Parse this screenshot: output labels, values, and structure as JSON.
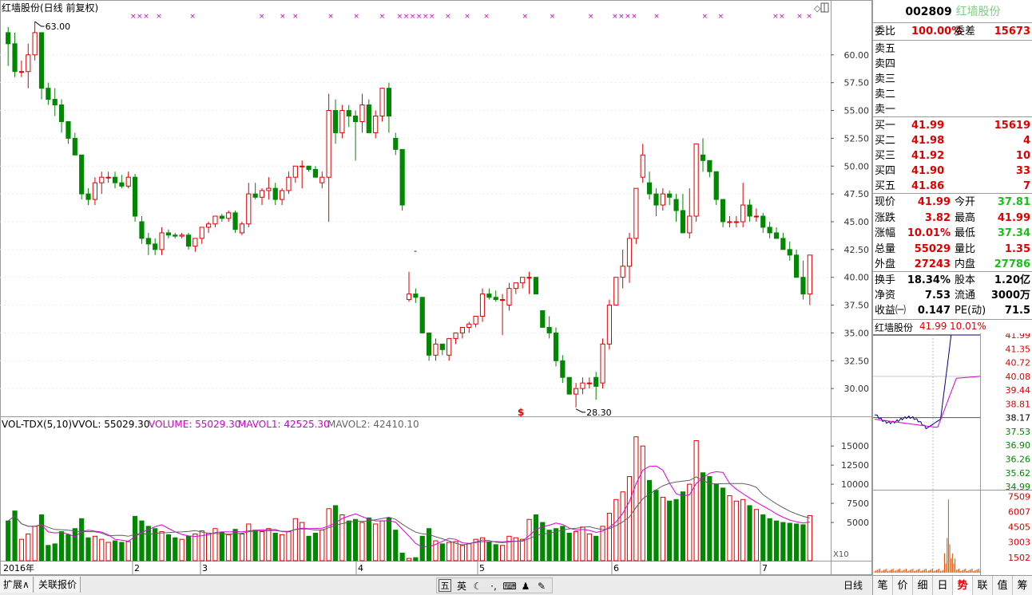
{
  "stock": {
    "code": "002809",
    "name": "红墙股份",
    "title": "红墙股份(日线 前复权)",
    "mini_title": "红墙股份",
    "mini_price": "41.99",
    "mini_pct": "10.01%"
  },
  "volume_header": {
    "name": "VOL-TDX(5,10)",
    "vvol": "VVOL: 55029.30",
    "volume": "VOLUME: 55029.30",
    "mavol1": "MAVOL1: 42525.30",
    "mavol2": "MAVOL2: 42410.10"
  },
  "annotations": {
    "high_label": "63.00",
    "low_label": "28.30",
    "year_label": "2016年",
    "dividend_marker": "$",
    "dash_marker": "-",
    "x10": "X10"
  },
  "price_axis": [
    "60.00",
    "57.50",
    "55.00",
    "52.50",
    "50.00",
    "47.50",
    "45.00",
    "42.50",
    "40.00",
    "37.50",
    "35.00",
    "32.50",
    "30.00"
  ],
  "volume_axis": [
    "15000",
    "12500",
    "10000",
    "7500",
    "5000"
  ],
  "month_labels": [
    "2",
    "3",
    "4",
    "5",
    "6",
    "7"
  ],
  "quote": {
    "weibi_label": "委比",
    "weibi": "100.00%",
    "weicha_label": "委差",
    "weicha": "15673",
    "sells": [
      {
        "label": "卖五",
        "price": "",
        "vol": ""
      },
      {
        "label": "卖四",
        "price": "",
        "vol": ""
      },
      {
        "label": "卖三",
        "price": "",
        "vol": ""
      },
      {
        "label": "卖二",
        "price": "",
        "vol": ""
      },
      {
        "label": "卖一",
        "price": "",
        "vol": ""
      }
    ],
    "buys": [
      {
        "label": "买一",
        "price": "41.99",
        "vol": "15619"
      },
      {
        "label": "买二",
        "price": "41.98",
        "vol": "4"
      },
      {
        "label": "买三",
        "price": "41.92",
        "vol": "10"
      },
      {
        "label": "买四",
        "price": "41.90",
        "vol": "33"
      },
      {
        "label": "买五",
        "price": "41.86",
        "vol": "7"
      }
    ],
    "stats": [
      {
        "l1": "现价",
        "v1": "41.99",
        "c1": "red",
        "l2": "今开",
        "v2": "37.81",
        "c2": "green"
      },
      {
        "l1": "涨跌",
        "v1": "3.82",
        "c1": "red",
        "l2": "最高",
        "v2": "41.99",
        "c2": "red"
      },
      {
        "l1": "涨幅",
        "v1": "10.01%",
        "c1": "red",
        "l2": "最低",
        "v2": "37.34",
        "c2": "green"
      },
      {
        "l1": "总量",
        "v1": "55029",
        "c1": "red",
        "l2": "量比",
        "v2": "1.35",
        "c2": "red"
      },
      {
        "l1": "外盘",
        "v1": "27243",
        "c1": "red",
        "l2": "内盘",
        "v2": "27786",
        "c2": "green"
      }
    ],
    "fund": [
      {
        "l1": "换手",
        "v1": "18.34%",
        "l2": "股本",
        "v2": "1.20亿"
      },
      {
        "l1": "净资",
        "v1": "7.53",
        "l2": "流通",
        "v2": "3000万"
      },
      {
        "l1": "收益㈠",
        "v1": "0.147",
        "l2": "PE(动)",
        "v2": "71.5"
      }
    ]
  },
  "mini_price_axis": [
    "41.99",
    "41.35",
    "40.72",
    "40.08",
    "39.44",
    "38.81",
    "38.17",
    "37.53",
    "36.90",
    "36.26",
    "35.62",
    "34.99"
  ],
  "mini_vol_axis": [
    "7509",
    "6007",
    "4505",
    "3003",
    "1502"
  ],
  "bottom_tabs": {
    "expand": "扩展∧",
    "related": "关联报价",
    "period": "日线"
  },
  "toolbar": {
    "t1": "五",
    "t2": "英"
  },
  "right_tabs": [
    "笔",
    "价",
    "细",
    "日",
    "势",
    "联",
    "值",
    "筹"
  ],
  "colors": {
    "up": "#e00000",
    "down": "#008800",
    "ma1": "#e000e0",
    "ma2": "#606060",
    "mini_line": "#000080",
    "mini_avg": "#d000d0",
    "mini_vol": "#e05000"
  },
  "chart_data": {
    "type": "candlestick",
    "ylim": [
      27.5,
      63.5
    ],
    "candles": [
      [
        62,
        62.5,
        59,
        61,
        5200
      ],
      [
        61,
        62,
        58,
        58.5,
        6500
      ],
      [
        58.5,
        59.5,
        58,
        58.5,
        2800
      ],
      [
        58.5,
        61,
        57,
        60,
        3500
      ],
      [
        60,
        63,
        59.5,
        62,
        4500
      ],
      [
        62,
        62,
        56,
        57,
        6000
      ],
      [
        57,
        57.5,
        55.5,
        56,
        2000
      ],
      [
        56,
        57,
        54.5,
        55.5,
        2200
      ],
      [
        55.5,
        56,
        53,
        54,
        3800
      ],
      [
        54,
        54,
        52,
        52.5,
        3400
      ],
      [
        52.5,
        53,
        51,
        51,
        4200
      ],
      [
        51,
        51,
        47,
        47.5,
        5500
      ],
      [
        47.5,
        48,
        46.5,
        47,
        3000
      ],
      [
        47,
        49,
        46.5,
        48.5,
        3200
      ],
      [
        48.5,
        49.5,
        47.5,
        49,
        2800
      ],
      [
        49,
        49.5,
        48.5,
        49,
        2400
      ],
      [
        49,
        49.5,
        48,
        48.5,
        2600
      ],
      [
        48.5,
        49.2,
        48,
        48.2,
        2400
      ],
      [
        48.2,
        49.5,
        48,
        49,
        2500
      ],
      [
        49,
        49.3,
        45,
        45.5,
        5800
      ],
      [
        45,
        45.5,
        43,
        43.5,
        5200
      ],
      [
        43.5,
        44,
        42,
        43,
        4500
      ],
      [
        43,
        43.5,
        42,
        42.5,
        4200
      ],
      [
        42.5,
        44.5,
        42,
        44,
        3800
      ],
      [
        44,
        44.3,
        43.5,
        43.8,
        3400
      ],
      [
        43.8,
        44,
        43.5,
        43.7,
        3000
      ],
      [
        43.7,
        44,
        43.5,
        43.8,
        2800
      ],
      [
        43.8,
        44,
        42.5,
        42.8,
        3200
      ],
      [
        42.8,
        43.5,
        42.3,
        43.5,
        3500
      ],
      [
        43.5,
        44.5,
        43,
        44.5,
        3900
      ],
      [
        44.5,
        45,
        44,
        44.8,
        3600
      ],
      [
        44.8,
        45.5,
        44.5,
        45.5,
        4200
      ],
      [
        45.5,
        45.7,
        45,
        45.3,
        3700
      ],
      [
        45.3,
        46,
        45,
        45.8,
        3400
      ],
      [
        45.8,
        46,
        44,
        44.3,
        4100
      ],
      [
        44,
        45,
        43.8,
        44.8,
        3500
      ],
      [
        44.8,
        48.5,
        44.5,
        47.5,
        4800
      ],
      [
        47.5,
        48.5,
        47,
        47.2,
        4000
      ],
      [
        47.2,
        48,
        46.5,
        47.8,
        3800
      ],
      [
        47.8,
        49,
        47,
        48,
        4200
      ],
      [
        48,
        48.5,
        46.5,
        47,
        3600
      ],
      [
        47,
        48,
        46.5,
        47.8,
        3400
      ],
      [
        47.8,
        49.5,
        47.5,
        49,
        3800
      ],
      [
        49,
        50,
        48.5,
        50,
        5500
      ],
      [
        50,
        50.5,
        48,
        50,
        5000
      ],
      [
        50,
        50,
        49.5,
        49.7,
        3200
      ],
      [
        49.7,
        50,
        49,
        49,
        3600
      ],
      [
        48.5,
        49.5,
        48,
        49,
        4000
      ],
      [
        49,
        56.5,
        45,
        55,
        6800
      ],
      [
        55,
        56,
        52,
        53,
        7200
      ],
      [
        53,
        55.5,
        52.5,
        55,
        6000
      ],
      [
        55,
        55.5,
        53.5,
        54.5,
        5200
      ],
      [
        54.5,
        55,
        50.5,
        54,
        5400
      ],
      [
        54,
        56.5,
        53,
        55.5,
        5000
      ],
      [
        55.5,
        56,
        53,
        53,
        5600
      ],
      [
        53,
        55,
        52.5,
        54.5,
        4800
      ],
      [
        54.5,
        57,
        54,
        57,
        5200
      ],
      [
        57,
        57.5,
        53,
        54.5,
        5600
      ],
      [
        52.5,
        53,
        51,
        51.5,
        4000
      ],
      [
        51.5,
        51.5,
        46,
        46.5,
        1000
      ],
      [
        38,
        40.5,
        37.8,
        38.5,
        300
      ],
      [
        38.5,
        39,
        37.7,
        38.2,
        400
      ],
      [
        38.2,
        38.2,
        35,
        35,
        3200
      ],
      [
        35,
        35,
        32.5,
        33,
        4200
      ],
      [
        33,
        34.5,
        32.5,
        34,
        2600
      ],
      [
        34,
        34,
        33,
        33.5,
        2200
      ],
      [
        33,
        34,
        32.5,
        34.5,
        2400
      ],
      [
        34.5,
        35,
        34,
        35,
        2500
      ],
      [
        35,
        35.5,
        34.5,
        35.5,
        2000
      ],
      [
        35.5,
        36,
        35,
        35.8,
        2200
      ],
      [
        35.8,
        36.5,
        35.5,
        36.5,
        2800
      ],
      [
        36.5,
        39,
        36,
        38.5,
        3000
      ],
      [
        38.5,
        39,
        38,
        38.2,
        2400
      ],
      [
        38.2,
        38.8,
        37.8,
        38,
        2100
      ],
      [
        38,
        38.5,
        34.8,
        38,
        2000
      ],
      [
        37.5,
        39.5,
        37,
        39,
        3200
      ],
      [
        39,
        39.5,
        38.5,
        39.5,
        3000
      ],
      [
        39.5,
        40,
        39,
        40,
        2800
      ],
      [
        40,
        40.5,
        38.5,
        40,
        5400
      ],
      [
        40,
        40,
        38.5,
        38.5,
        6000
      ],
      [
        37,
        37,
        35.5,
        35.5,
        5000
      ],
      [
        35.5,
        36.5,
        34.5,
        35,
        4000
      ],
      [
        35,
        35.5,
        32,
        32.5,
        4200
      ],
      [
        32.5,
        33,
        30.5,
        31,
        4500
      ],
      [
        31,
        31,
        29.5,
        29.5,
        3600
      ],
      [
        29.5,
        30.5,
        28.3,
        30,
        3800
      ],
      [
        30,
        31,
        29.5,
        30.5,
        4400
      ],
      [
        30.5,
        31,
        30,
        30.5,
        3500
      ],
      [
        31,
        31.5,
        29,
        30.2,
        3200
      ],
      [
        30.5,
        34.5,
        30,
        34,
        4500
      ],
      [
        34,
        38,
        33.5,
        37.5,
        6200
      ],
      [
        37.5,
        40,
        38.5,
        40,
        8000
      ],
      [
        40,
        42.5,
        39,
        41,
        9000
      ],
      [
        41,
        44,
        39.5,
        43.5,
        11000
      ],
      [
        43.5,
        48,
        43,
        48,
        16200
      ],
      [
        49,
        52,
        48.5,
        51,
        15000
      ],
      [
        48.5,
        49.5,
        47,
        47.5,
        10500
      ],
      [
        47.5,
        48,
        45.5,
        46.5,
        9200
      ],
      [
        46.5,
        48,
        46,
        47.5,
        8300
      ],
      [
        47.5,
        47.8,
        46.5,
        47.2,
        7800
      ],
      [
        47,
        47.5,
        45,
        46,
        8000
      ],
      [
        46,
        47.5,
        44,
        44,
        9000
      ],
      [
        44,
        48,
        43.5,
        45.5,
        10000
      ],
      [
        45.5,
        52,
        45,
        52,
        15700
      ],
      [
        51,
        52.5,
        49.5,
        50.5,
        11500
      ],
      [
        50.5,
        50.5,
        49,
        49.5,
        11000
      ],
      [
        49.5,
        49.5,
        46.5,
        47,
        10000
      ],
      [
        47,
        47,
        44.5,
        45,
        9500
      ],
      [
        45,
        45.5,
        44.5,
        45,
        8500
      ],
      [
        45,
        45.5,
        44.5,
        45,
        7800
      ],
      [
        45,
        48.5,
        44.5,
        46.5,
        8000
      ],
      [
        46.5,
        47,
        45,
        45.5,
        7200
      ],
      [
        45.5,
        46.2,
        45,
        45.5,
        6700
      ],
      [
        45.5,
        45.8,
        44,
        44.5,
        6000
      ],
      [
        44.5,
        45,
        43.5,
        44,
        5500
      ],
      [
        44,
        44.5,
        43.5,
        43.5,
        5200
      ],
      [
        43.5,
        44,
        42.5,
        42.5,
        5000
      ],
      [
        42.5,
        43.2,
        41.5,
        42,
        4900
      ],
      [
        42,
        42.5,
        40,
        40,
        4800
      ],
      [
        40,
        41.5,
        38,
        38.5,
        4700
      ],
      [
        38.5,
        42,
        37.5,
        42,
        5900
      ]
    ]
  }
}
